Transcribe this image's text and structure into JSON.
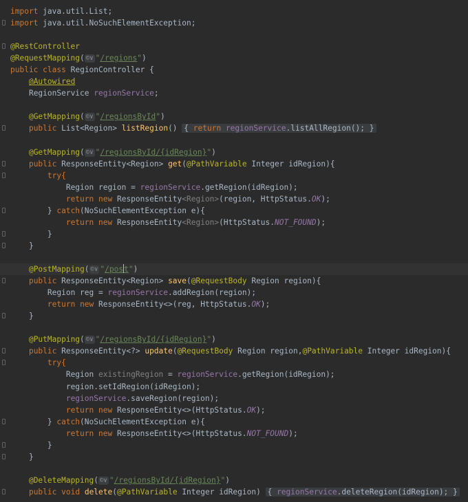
{
  "code": {
    "imports": {
      "kw": "import",
      "list": "java.util.List;",
      "nsee": "java.util.NoSuchElementException;"
    },
    "ann": {
      "rest_controller": "@RestController",
      "request_mapping": "@RequestMapping",
      "autowired": "@Autowired",
      "get_mapping": "@GetMapping",
      "post_mapping": "@PostMapping",
      "put_mapping": "@PutMapping",
      "delete_mapping": "@DeleteMapping",
      "path_variable": "@PathVariable",
      "request_body": "@RequestBody"
    },
    "inlay_hint": "©∨",
    "kw": {
      "public": "public",
      "class": "class",
      "return": "return",
      "new": "new",
      "try": "try",
      "catch": "catch",
      "void": "void",
      "brace_try": "try{"
    },
    "strings": {
      "regions": "/regions",
      "regions_by_id": "/regionsById",
      "regions_by_id_param": "/regionsById/{idRegion}",
      "post_a": "/pos",
      "post_b": "t"
    },
    "lines": {
      "class_name": "RegionController {",
      "service_type": "RegionService",
      "service_field": "regionService",
      "semicolon": ";",
      "list_type": "List<Region>",
      "list_region": "listRegion",
      "list_all": "listAllRegion",
      "response_entity_region": "ResponseEntity<Region>",
      "response_entity_wild": "ResponseEntity<?>",
      "response_entity": "ResponseEntity",
      "get": "get",
      "save": "save",
      "update": "update",
      "delete": "delete",
      "integer_id": "Integer idRegion",
      "region_region": "Region region",
      "region_region_eq": "Region region =",
      "get_region_call": "getRegion",
      "add_region": "addRegion",
      "save_region": "saveRegion",
      "delete_region": "deleteRegion",
      "set_id": "region.setIdRegion(idRegion);",
      "region_t": "Region",
      "reg_t": "Region reg =",
      "existing": "existingRegion",
      "nsee_e": "(NoSuchElementException e){",
      "http_ok": "OK",
      "http_nf": "NOT_FOUND",
      "http_status": "HttpStatus.",
      "diamond_region": "<Region>"
    }
  }
}
